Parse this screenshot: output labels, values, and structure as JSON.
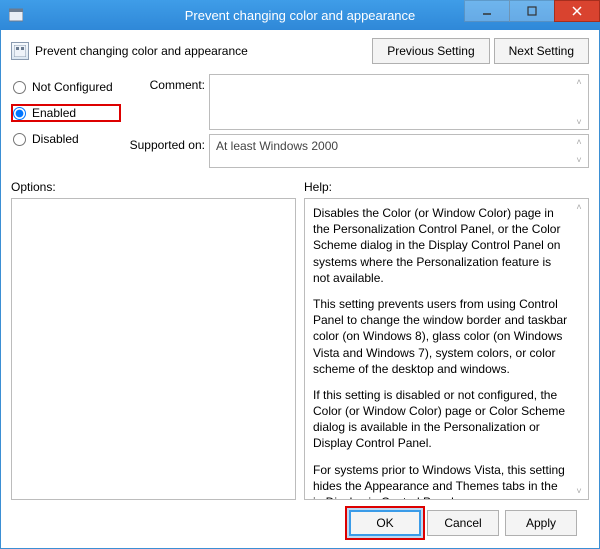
{
  "window": {
    "title": "Prevent changing color and appearance",
    "sysicon": "policy-icon"
  },
  "header": {
    "setting_name": "Prevent changing color and appearance",
    "previous_label": "Previous Setting",
    "next_label": "Next Setting"
  },
  "state": {
    "not_configured": "Not Configured",
    "enabled": "Enabled",
    "disabled": "Disabled",
    "selected": "enabled"
  },
  "fields": {
    "comment_label": "Comment:",
    "comment_value": "",
    "supported_label": "Supported on:",
    "supported_value": "At least Windows 2000"
  },
  "panels": {
    "options_label": "Options:",
    "help_label": "Help:"
  },
  "help": {
    "p1": "Disables the Color (or Window Color) page in the Personalization Control Panel, or the Color Scheme dialog in the Display Control Panel on systems where the Personalization feature is not available.",
    "p2": "This setting prevents users from using Control Panel to change the window border and taskbar color (on Windows 8), glass color (on Windows Vista and Windows 7), system colors, or color scheme of the desktop and windows.",
    "p3": "If this setting is disabled or not configured, the Color (or Window Color) page or Color Scheme dialog is available in the Personalization or Display Control Panel.",
    "p4": "For systems prior to Windows Vista, this setting hides the Appearance and Themes tabs in the in Display in Control Panel."
  },
  "buttons": {
    "ok": "OK",
    "cancel": "Cancel",
    "apply": "Apply"
  }
}
